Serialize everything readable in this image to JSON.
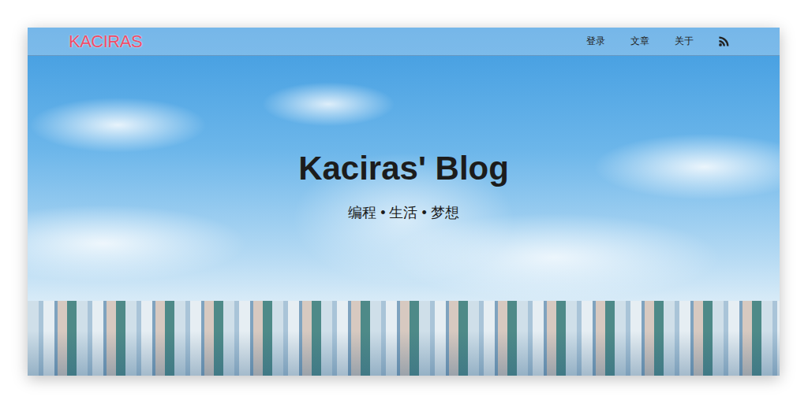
{
  "header": {
    "logo": "KACIRAS",
    "nav": [
      {
        "label": "登录"
      },
      {
        "label": "文章"
      },
      {
        "label": "关于"
      }
    ]
  },
  "hero": {
    "title": "Kaciras' Blog",
    "subtitle": "编程 • 生活 • 梦想"
  }
}
